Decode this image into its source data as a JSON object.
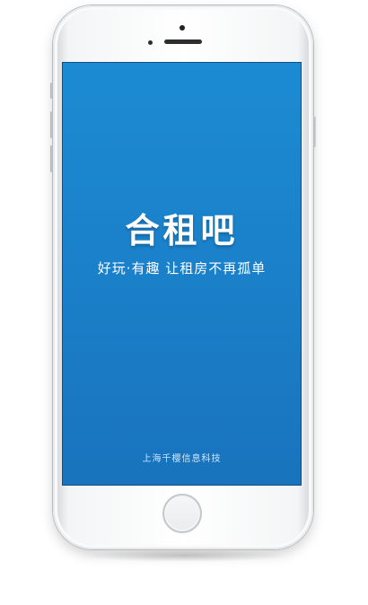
{
  "app": {
    "name": "合租吧",
    "tagline": "好玩·有趣  让租房不再孤单",
    "company": "上海千樱信息科技"
  },
  "colors": {
    "screen_top": "#1c8bd3",
    "screen_bottom": "#1973bd",
    "text": "#ffffff"
  },
  "icons": {
    "home_button": "home-button-icon",
    "camera": "front-camera-icon",
    "earpiece": "speaker-icon"
  }
}
